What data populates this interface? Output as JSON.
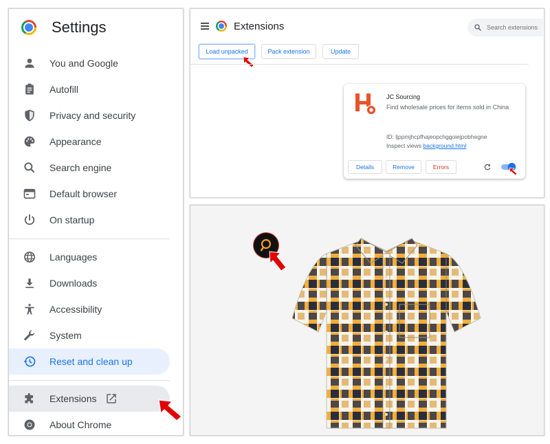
{
  "settings": {
    "title": "Settings",
    "items": [
      {
        "label": "You and Google"
      },
      {
        "label": "Autofill"
      },
      {
        "label": "Privacy and security"
      },
      {
        "label": "Appearance"
      },
      {
        "label": "Search engine"
      },
      {
        "label": "Default browser"
      },
      {
        "label": "On startup"
      },
      {
        "label": "Languages"
      },
      {
        "label": "Downloads"
      },
      {
        "label": "Accessibility"
      },
      {
        "label": "System"
      },
      {
        "label": "Reset and clean up"
      },
      {
        "label": "Extensions"
      },
      {
        "label": "About Chrome"
      }
    ],
    "selected_item": "Reset and clean up"
  },
  "extensions_page": {
    "title": "Extensions",
    "search_placeholder": "Search extensions",
    "buttons": {
      "load_unpacked": "Load unpacked",
      "pack_extension": "Pack extension",
      "update": "Update"
    },
    "card": {
      "name": "JC Sourcing",
      "description": "Find wholesale prices for items sold in China",
      "id_text": "ID: ljppmjhcpfhajeopchggoiejpobhegne",
      "inspect_label": "Inspect views",
      "inspect_link": "background.html",
      "details_label": "Details",
      "remove_label": "Remove",
      "errors_label": "Errors",
      "enabled": true
    }
  },
  "product": {
    "image": "plaid-short-sleeve-shirt"
  },
  "colors": {
    "accent_blue": "#1a73e8",
    "selected_bg": "#e8f0fe",
    "error_red": "#d93025",
    "annotation_arrow": "#e00000",
    "extension_orange": "#e8542a"
  }
}
